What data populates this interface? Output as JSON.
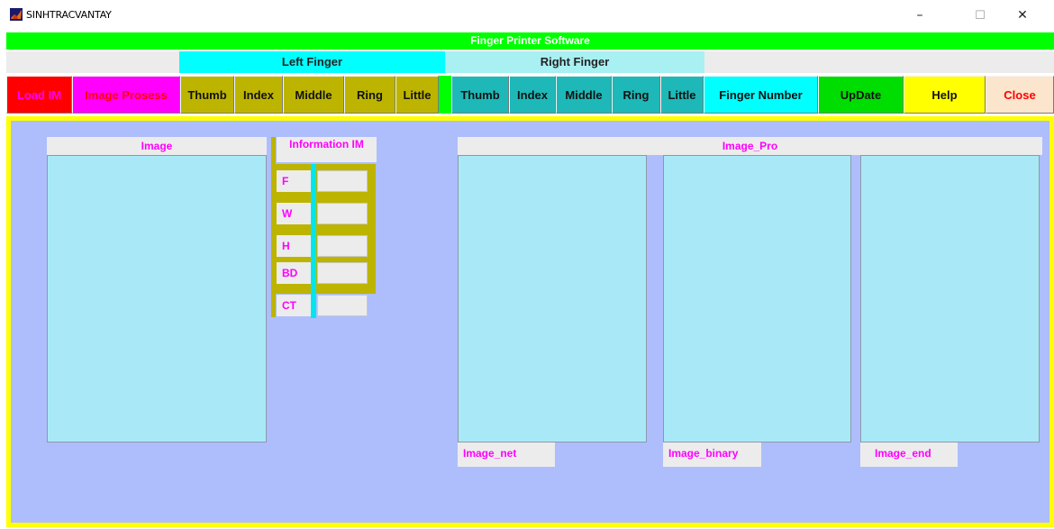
{
  "window": {
    "title": "SINHTRACVANTAY",
    "minimize_glyph": "–",
    "maximize_glyph": "☐",
    "close_glyph": "✕"
  },
  "banner": "Finger Printer Software",
  "groups": {
    "left": "Left Finger",
    "right": "Right Finger"
  },
  "toolbar": {
    "load": "Load IM",
    "process": "Image Prosess",
    "left_thumb": "Thumb",
    "left_index": "Index",
    "left_middle": "Middle",
    "left_ring": "Ring",
    "left_little": "Little",
    "right_thumb": "Thumb",
    "right_index": "Index",
    "right_middle": "Middle",
    "right_ring": "Ring",
    "right_little": "Little",
    "finger_number": "Finger Number",
    "update": "UpDate",
    "help": "Help",
    "close": "Close"
  },
  "image_pane": {
    "title": "Image"
  },
  "info_pane": {
    "title": "Information IM",
    "fields": [
      {
        "label": "F",
        "value": ""
      },
      {
        "label": "W",
        "value": ""
      },
      {
        "label": "H",
        "value": ""
      },
      {
        "label": "BD",
        "value": ""
      },
      {
        "label": "CT",
        "value": ""
      }
    ]
  },
  "image_pro": {
    "title": "Image_Pro",
    "net": "Image_net",
    "binary": "Image_binary",
    "end": "Image_end"
  },
  "colors": {
    "banner": "#00ff00",
    "left_group": "#00ffff",
    "right_group": "#a8f0f2",
    "workspace": "#aebefc",
    "workspace_border": "#ffff00",
    "panel_fill": "#a9e9f7",
    "label_text": "#ff00ff",
    "load_button": "#ff0000",
    "process_button": "#ff00ff",
    "left_finger_button": "#bdb400",
    "right_finger_button": "#1eb8b8",
    "finger_number_button": "#00ffff",
    "update_button": "#00dd00",
    "help_button": "#ffff00",
    "close_button": "#fbe5cc"
  }
}
